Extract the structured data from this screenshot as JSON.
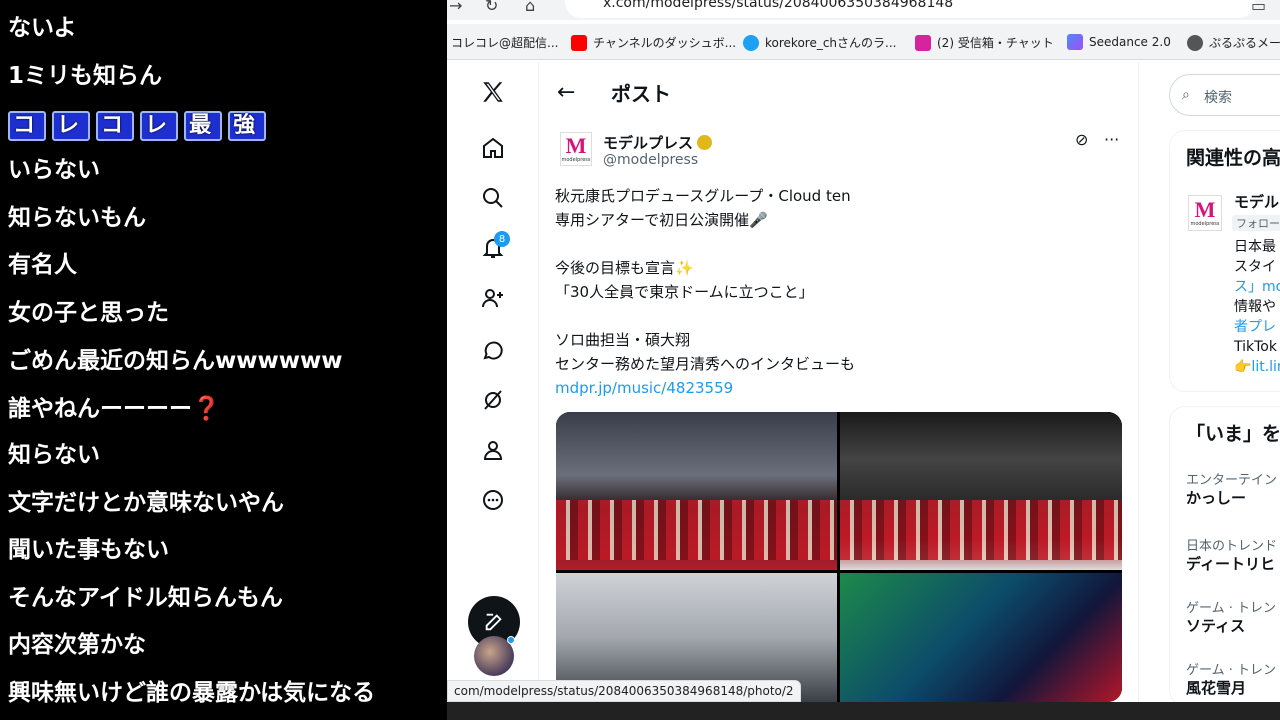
{
  "chat": {
    "lines": [
      "ないよ",
      "1ミリも知らん",
      "",
      "いらない",
      "知らないもん",
      "有名人",
      "女の子と思った",
      "ごめん最近の知らんwwwwww",
      "誰やねんーーーー",
      "知らない",
      "文字だけとか意味ないやん",
      "聞いた事もない",
      "そんなアイドル知らんもん",
      "内容次第かな",
      "興味無いけど誰の暴露かは気になる"
    ],
    "fancy_chars": [
      "コ",
      "レ",
      "コ",
      "レ",
      "最",
      "強"
    ],
    "question_mark": "❓"
  },
  "browser": {
    "url": "x.com/modelpress/status/2084006350384968148",
    "nav_back": "→",
    "nav_reload": "↻",
    "nav_home": "⌂",
    "bookmarks": [
      {
        "label": "コレコレ@超配信...",
        "color": "#888888"
      },
      {
        "label": "チャンネルのダッシュボ...",
        "color": "#ff0000"
      },
      {
        "label": "korekore_chさんのラ...",
        "color": "#1da1f2"
      },
      {
        "label": "(2) 受信箱・チャット",
        "color": "#d6249f"
      },
      {
        "label": "Seedance 2.0",
        "color": "#4d8cf5"
      },
      {
        "label": "ぷるぷるメーカ",
        "color": "#555555"
      }
    ],
    "status_url": "com/modelpress/status/2084006350384968148/photo/2"
  },
  "x": {
    "notification_count": "8",
    "header_title": "ポスト",
    "author": {
      "name": "モデルプレス",
      "handle": "@modelpress",
      "avatar_letter": "M",
      "avatar_sub": "modelpress"
    },
    "post": {
      "lines": [
        "秋元康氏プロデュースグループ・Cloud ten",
        "専用シアターで初日公演開催🎤",
        "",
        "今後の目標も宣言✨",
        "「30人全員で東京ドームに立つこと」",
        "",
        "ソロ曲担当・碩大翔",
        "センター務めた望月清秀へのインタビューも"
      ],
      "link": "mdpr.jp/music/4823559"
    },
    "search_placeholder": "検索",
    "related": {
      "title": "関連性の高",
      "name": "モデル",
      "follow": "フォロー",
      "bio_lines": [
        "日本最",
        "スタイ",
        "ス」mo",
        "情報や",
        "者プレ",
        "TikTok",
        "👉lit.lin"
      ]
    },
    "trends": {
      "title": "「いま」を",
      "items": [
        {
          "category": "エンターテイン",
          "name": "かっしー"
        },
        {
          "category": "日本のトレンド",
          "name": "ディートリヒ"
        },
        {
          "category": "ゲーム · トレント",
          "name": "ソティス"
        },
        {
          "category": "ゲーム · トレント",
          "name": "風花雪月"
        }
      ]
    }
  }
}
